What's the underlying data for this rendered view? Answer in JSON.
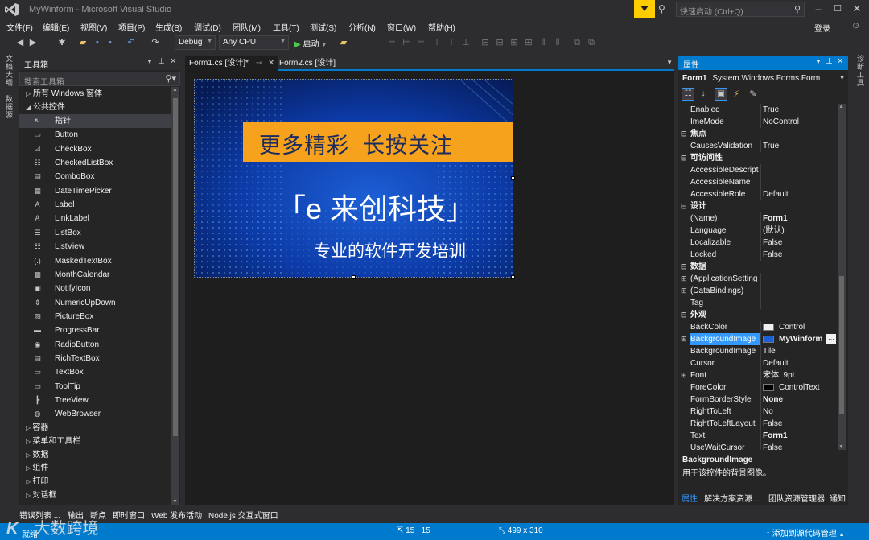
{
  "titlebar": {
    "title": "MyWinform - Microsoft Visual Studio",
    "quick_launch_placeholder": "快速启动 (Ctrl+Q)",
    "login": "登录"
  },
  "menu": [
    "文件(F)",
    "编辑(E)",
    "视图(V)",
    "项目(P)",
    "生成(B)",
    "调试(D)",
    "团队(M)",
    "工具(T)",
    "测试(S)",
    "分析(N)",
    "窗口(W)",
    "帮助(H)"
  ],
  "toolbar": {
    "config": "Debug",
    "platform": "Any CPU",
    "start_label": "启动"
  },
  "left_vtabs": [
    "文档大纲",
    "数据源"
  ],
  "right_vtabs": [
    "诊断工具"
  ],
  "toolbox": {
    "title": "工具箱",
    "search_placeholder": "搜索工具箱",
    "group_all": "所有 Windows 窗体",
    "group_common": "公共控件",
    "items": [
      {
        "label": "指针",
        "icon": "pointer-icon",
        "glyph": "↖"
      },
      {
        "label": "Button",
        "icon": "button-icon",
        "glyph": "▭"
      },
      {
        "label": "CheckBox",
        "icon": "checkbox-icon",
        "glyph": "☑"
      },
      {
        "label": "CheckedListBox",
        "icon": "checkedlistbox-icon",
        "glyph": "☷"
      },
      {
        "label": "ComboBox",
        "icon": "combobox-icon",
        "glyph": "▤"
      },
      {
        "label": "DateTimePicker",
        "icon": "datetimepicker-icon",
        "glyph": "▦"
      },
      {
        "label": "Label",
        "icon": "label-icon",
        "glyph": "A"
      },
      {
        "label": "LinkLabel",
        "icon": "linklabel-icon",
        "glyph": "A"
      },
      {
        "label": "ListBox",
        "icon": "listbox-icon",
        "glyph": "☰"
      },
      {
        "label": "ListView",
        "icon": "listview-icon",
        "glyph": "☷"
      },
      {
        "label": "MaskedTextBox",
        "icon": "maskedtextbox-icon",
        "glyph": "(.)"
      },
      {
        "label": "MonthCalendar",
        "icon": "monthcalendar-icon",
        "glyph": "▦"
      },
      {
        "label": "NotifyIcon",
        "icon": "notifyicon-icon",
        "glyph": "▣"
      },
      {
        "label": "NumericUpDown",
        "icon": "numericupdown-icon",
        "glyph": "⇕"
      },
      {
        "label": "PictureBox",
        "icon": "picturebox-icon",
        "glyph": "▨"
      },
      {
        "label": "ProgressBar",
        "icon": "progressbar-icon",
        "glyph": "▬"
      },
      {
        "label": "RadioButton",
        "icon": "radiobutton-icon",
        "glyph": "◉"
      },
      {
        "label": "RichTextBox",
        "icon": "richtextbox-icon",
        "glyph": "▤"
      },
      {
        "label": "TextBox",
        "icon": "textbox-icon",
        "glyph": "▭"
      },
      {
        "label": "ToolTip",
        "icon": "tooltip-icon",
        "glyph": "▭"
      },
      {
        "label": "TreeView",
        "icon": "treeview-icon",
        "glyph": "┣"
      },
      {
        "label": "WebBrowser",
        "icon": "webbrowser-icon",
        "glyph": "◍"
      }
    ],
    "groups": [
      "容器",
      "菜单和工具栏",
      "数据",
      "组件",
      "打印",
      "对话框"
    ]
  },
  "doc_tabs": [
    {
      "label": "Form1.cs [设计]*",
      "active": true
    },
    {
      "label": "Form2.cs [设计]",
      "active": false
    }
  ],
  "form_image": {
    "banner_text": "更多精彩  长按关注",
    "brand_text": "「e 来创科技」",
    "subtitle_text": "专业的软件开发培训"
  },
  "properties": {
    "title": "属性",
    "object_name": "Form1",
    "object_type": "System.Windows.Forms.Form",
    "rows": [
      {
        "kind": "prop",
        "name": "Enabled",
        "value": "True"
      },
      {
        "kind": "prop",
        "name": "ImeMode",
        "value": "NoControl"
      },
      {
        "kind": "cat",
        "name": "焦点"
      },
      {
        "kind": "prop",
        "name": "CausesValidation",
        "value": "True"
      },
      {
        "kind": "cat",
        "name": "可访问性"
      },
      {
        "kind": "prop",
        "name": "AccessibleDescript",
        "value": ""
      },
      {
        "kind": "prop",
        "name": "AccessibleName",
        "value": ""
      },
      {
        "kind": "prop",
        "name": "AccessibleRole",
        "value": "Default"
      },
      {
        "kind": "cat",
        "name": "设计"
      },
      {
        "kind": "prop",
        "name": "(Name)",
        "value": "Form1",
        "bold": true
      },
      {
        "kind": "prop",
        "name": "Language",
        "value": "(默认)"
      },
      {
        "kind": "prop",
        "name": "Localizable",
        "value": "False"
      },
      {
        "kind": "prop",
        "name": "Locked",
        "value": "False"
      },
      {
        "kind": "cat",
        "name": "数据"
      },
      {
        "kind": "prop",
        "name": "(ApplicationSetting",
        "value": "",
        "expand": true
      },
      {
        "kind": "prop",
        "name": "(DataBindings)",
        "value": "",
        "expand": true
      },
      {
        "kind": "prop",
        "name": "Tag",
        "value": ""
      },
      {
        "kind": "cat",
        "name": "外观"
      },
      {
        "kind": "prop",
        "name": "BackColor",
        "value": "Control",
        "swatch": "#f0f0f0"
      },
      {
        "kind": "prop",
        "name": "BackgroundImage",
        "value": "MyWinform",
        "bold": true,
        "selected": true,
        "expand": true
      },
      {
        "kind": "prop",
        "name": "BackgroundImage",
        "value": "Tile"
      },
      {
        "kind": "prop",
        "name": "Cursor",
        "value": "Default"
      },
      {
        "kind": "prop",
        "name": "Font",
        "value": "宋体, 9pt",
        "expand": true
      },
      {
        "kind": "prop",
        "name": "ForeColor",
        "value": "ControlText",
        "swatch": "#000000"
      },
      {
        "kind": "prop",
        "name": "FormBorderStyle",
        "value": "None",
        "bold": true
      },
      {
        "kind": "prop",
        "name": "RightToLeft",
        "value": "No"
      },
      {
        "kind": "prop",
        "name": "RightToLeftLayout",
        "value": "False"
      },
      {
        "kind": "prop",
        "name": "Text",
        "value": "Form1",
        "bold": true
      },
      {
        "kind": "prop",
        "name": "UseWaitCursor",
        "value": "False"
      }
    ],
    "desc_title": "BackgroundImage",
    "desc_text": "用于该控件的背景图像。",
    "bottom_tabs": [
      "属性",
      "解决方案资源...",
      "团队资源管理器",
      "通知"
    ]
  },
  "bottom_tabs": [
    "错误列表 ...",
    "输出",
    "断点",
    "即时窗口",
    "Web 发布活动",
    "Node.js 交互式窗口"
  ],
  "statusbar": {
    "ready": "就绪",
    "position": "15 , 15",
    "size": "499 x 310",
    "source_control": "添加到源代码管理",
    "watermark": "大数跨境"
  },
  "colors": {
    "accent": "#007acc",
    "selection": "#3399ff",
    "banner_orange": "#f6a21c",
    "notification_yellow": "#ffcc00"
  }
}
